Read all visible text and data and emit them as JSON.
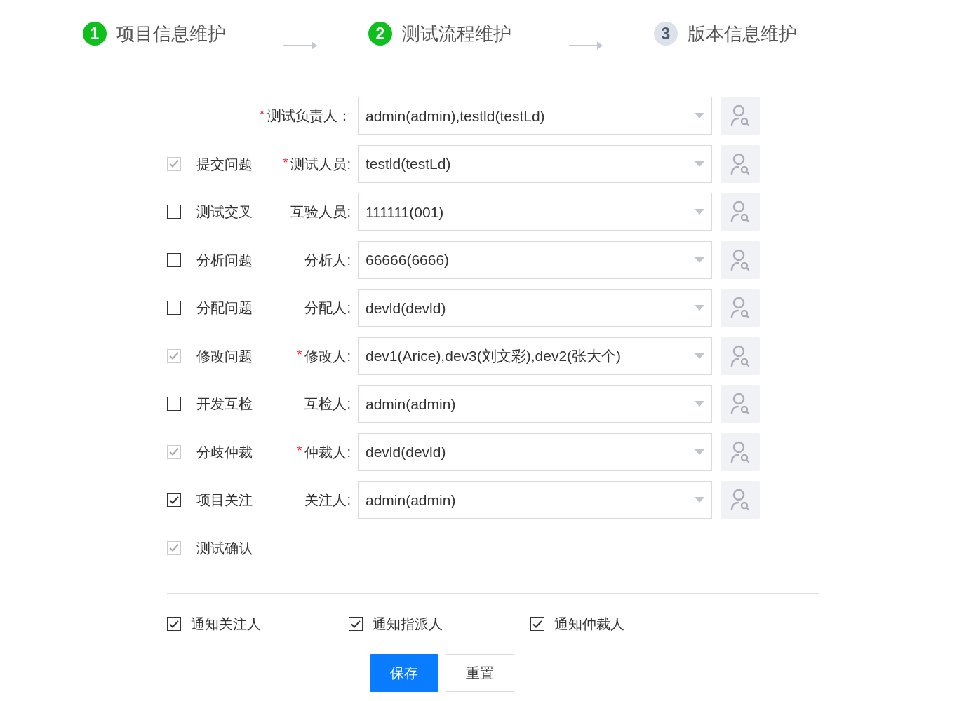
{
  "steps": [
    {
      "number": "1",
      "title": "项目信息维护",
      "active": true
    },
    {
      "number": "2",
      "title": "测试流程维护",
      "active": true
    },
    {
      "number": "3",
      "title": "版本信息维护",
      "active": false
    }
  ],
  "rows": [
    {
      "field": {
        "marker": "*",
        "label": "测试负责人：",
        "value": "admin(admin),testld(testLd)"
      }
    },
    {
      "task": {
        "label": "提交问题",
        "checked": true,
        "disabled": true
      },
      "field": {
        "marker": "*",
        "label": "测试人员:",
        "value": "testld(testLd)"
      }
    },
    {
      "task": {
        "label": "测试交叉",
        "checked": false,
        "disabled": false
      },
      "field": {
        "label": "互验人员:",
        "value": "111111(001)"
      }
    },
    {
      "task": {
        "label": "分析问题",
        "checked": false,
        "disabled": false
      },
      "field": {
        "label": "分析人:",
        "value": "66666(6666)"
      }
    },
    {
      "task": {
        "label": "分配问题",
        "checked": false,
        "disabled": false
      },
      "field": {
        "label": "分配人:",
        "value": "devld(devld)"
      }
    },
    {
      "task": {
        "label": "修改问题",
        "checked": true,
        "disabled": true
      },
      "field": {
        "marker": "*",
        "label": "修改人:",
        "value": "dev1(Arice),dev3(刘文彩),dev2(张大个)"
      }
    },
    {
      "task": {
        "label": "开发互检",
        "checked": false,
        "disabled": false
      },
      "field": {
        "label": "互检人:",
        "value": "admin(admin)"
      }
    },
    {
      "task": {
        "label": "分歧仲裁",
        "checked": true,
        "disabled": true
      },
      "field": {
        "marker": "*",
        "label": "仲裁人:",
        "value": "devld(devld)"
      }
    },
    {
      "task": {
        "label": "项目关注",
        "checked": true,
        "disabled": false
      },
      "field": {
        "label": "关注人:",
        "value": "admin(admin)"
      }
    },
    {
      "task": {
        "label": "测试确认",
        "checked": true,
        "disabled": true
      }
    }
  ],
  "notify": [
    {
      "label": "通知关注人",
      "checked": true
    },
    {
      "label": "通知指派人",
      "checked": true
    },
    {
      "label": "通知仲裁人",
      "checked": true
    }
  ],
  "buttons": [
    {
      "label": "保存",
      "kind": "primary"
    },
    {
      "label": "重置",
      "kind": "default"
    }
  ]
}
